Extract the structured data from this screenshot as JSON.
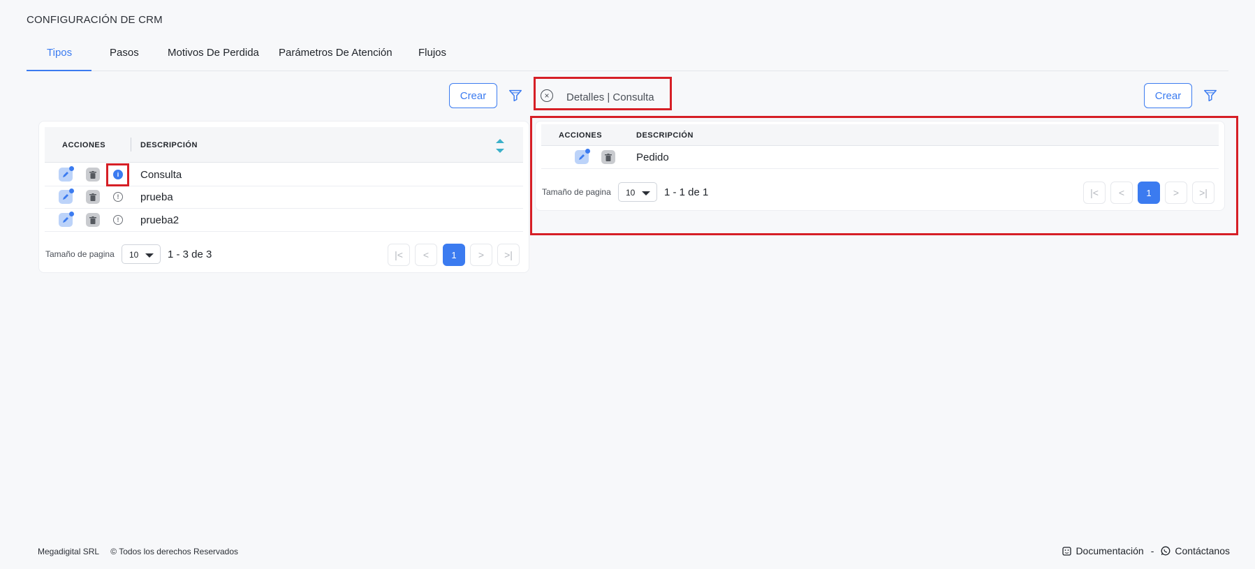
{
  "page_title": "CONFIGURACIÓN DE CRM",
  "tabs": [
    {
      "label": "Tipos",
      "active": true
    },
    {
      "label": "Pasos"
    },
    {
      "label": "Motivos De Perdida"
    },
    {
      "label": "Parámetros De Atención"
    },
    {
      "label": "Flujos"
    }
  ],
  "left": {
    "create_label": "Crear",
    "columns": {
      "actions": "ACCIONES",
      "description": "DESCRIPCIÓN"
    },
    "rows": [
      {
        "description": "Consulta"
      },
      {
        "description": "prueba"
      },
      {
        "description": "prueba2"
      }
    ],
    "pager": {
      "size_label": "Tamaño de pagina",
      "size_value": "10",
      "range": "1 - 3 de 3",
      "current_page": "1"
    }
  },
  "detail": {
    "title": "Detalles | Consulta",
    "create_label": "Crear",
    "columns": {
      "actions": "ACCIONES",
      "description": "DESCRIPCIÓN"
    },
    "rows": [
      {
        "description": "Pedido"
      }
    ],
    "pager": {
      "size_label": "Tamaño de pagina",
      "size_value": "10",
      "range": "1 - 1 de 1",
      "current_page": "1"
    }
  },
  "footer": {
    "company": "Megadigital SRL",
    "rights": "© Todos los derechos Reservados",
    "docs": "Documentación",
    "separator": "-",
    "contact": "Contáctanos"
  },
  "colors": {
    "accent": "#3b7bf0",
    "highlight": "#d61f26"
  }
}
